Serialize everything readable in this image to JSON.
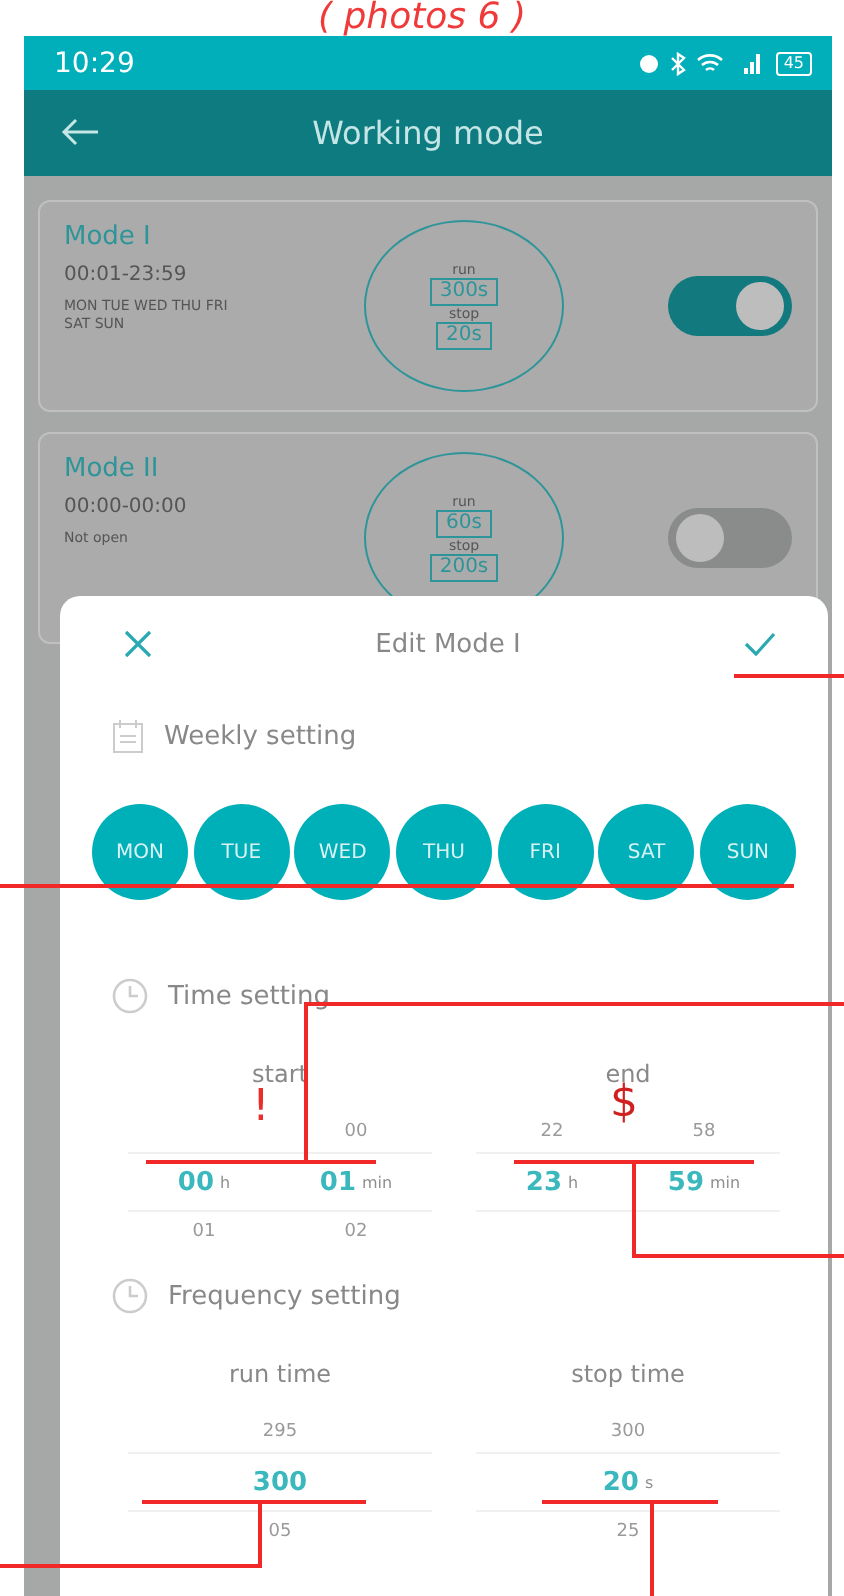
{
  "annotation": "( photos 6 )",
  "status_bar": {
    "time": "10:29",
    "battery": "45"
  },
  "app_bar": {
    "title": "Working mode"
  },
  "modes": [
    {
      "title": "Mode I",
      "time": "00:01-23:59",
      "days": "MON TUE WED THU FRI SAT SUN",
      "run_label": "run",
      "run": "300s",
      "stop_label": "stop",
      "stop": "20s",
      "on": true
    },
    {
      "title": "Mode II",
      "time": "00:00-00:00",
      "days": "Not open",
      "run_label": "run",
      "run": "60s",
      "stop_label": "stop",
      "stop": "200s",
      "on": false
    }
  ],
  "sheet": {
    "title": "Edit Mode I",
    "weekly": {
      "label": "Weekly setting",
      "days": [
        {
          "label": "MON",
          "selected": true
        },
        {
          "label": "TUE",
          "selected": true
        },
        {
          "label": "WED",
          "selected": true
        },
        {
          "label": "THU",
          "selected": true
        },
        {
          "label": "FRI",
          "selected": true
        },
        {
          "label": "SAT",
          "selected": true
        },
        {
          "label": "SUN",
          "selected": true
        }
      ]
    },
    "time": {
      "label": "Time setting",
      "columns": [
        {
          "label": "start",
          "pickers": [
            {
              "value": "00",
              "unit": "h",
              "below": "01"
            },
            {
              "above": "00",
              "value": "01",
              "unit": "min",
              "below": "02"
            }
          ]
        },
        {
          "label": "end",
          "pickers": [
            {
              "above": "22",
              "value": "23",
              "unit": "h"
            },
            {
              "above": "58",
              "value": "59",
              "unit": "min"
            }
          ]
        }
      ]
    },
    "frequency": {
      "label": "Frequency setting",
      "columns": [
        {
          "label": "run time",
          "above": "295",
          "value": "300",
          "below": "05"
        },
        {
          "label": "stop time",
          "above": "300",
          "value": "20",
          "unit": "s",
          "below": "25"
        }
      ]
    }
  },
  "marks": [
    "!",
    "$"
  ]
}
